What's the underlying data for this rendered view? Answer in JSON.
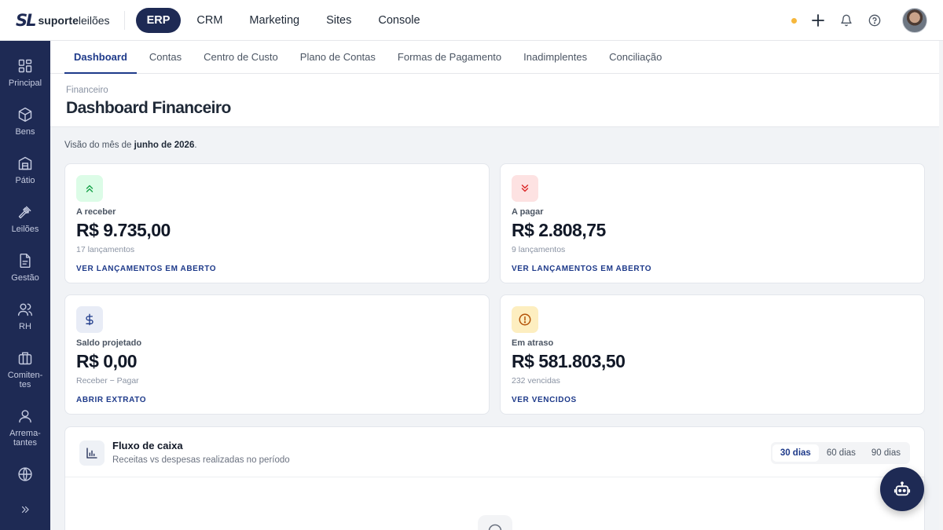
{
  "brand": {
    "mark": "SL",
    "name_bold": "suporte",
    "name_rest": "leilões"
  },
  "top_nav": [
    {
      "label": "ERP",
      "active": true
    },
    {
      "label": "CRM",
      "active": false
    },
    {
      "label": "Marketing",
      "active": false
    },
    {
      "label": "Sites",
      "active": false
    },
    {
      "label": "Console",
      "active": false
    }
  ],
  "top_right": {
    "status_dot_color": "#f6b73c",
    "icons": [
      "plus-icon",
      "bell-icon",
      "help-icon"
    ],
    "avatar": "user-avatar"
  },
  "sidebar": {
    "items": [
      {
        "label": "Principal",
        "icon": "grid-icon"
      },
      {
        "label": "Bens",
        "icon": "box-icon"
      },
      {
        "label": "Pátio",
        "icon": "warehouse-icon"
      },
      {
        "label": "Leilões",
        "icon": "gavel-icon"
      },
      {
        "label": "Gestão",
        "icon": "document-icon"
      },
      {
        "label": "RH",
        "icon": "users-icon"
      },
      {
        "label": "Comiten-",
        "label2": "tes",
        "icon": "briefcase-icon"
      },
      {
        "label": "Arrema-",
        "label2": "tantes",
        "icon": "user-icon"
      },
      {
        "label": "",
        "icon": "globe-icon"
      }
    ],
    "expand_icon": "double-chevron-right-icon"
  },
  "tabs": [
    {
      "label": "Dashboard",
      "active": true
    },
    {
      "label": "Contas",
      "active": false
    },
    {
      "label": "Centro de Custo",
      "active": false
    },
    {
      "label": "Plano de Contas",
      "active": false
    },
    {
      "label": "Formas de Pagamento",
      "active": false
    },
    {
      "label": "Inadimplentes",
      "active": false
    },
    {
      "label": "Conciliação",
      "active": false
    }
  ],
  "page": {
    "breadcrumb": "Financeiro",
    "title": "Dashboard Financeiro",
    "overview_prefix": "Visão do mês de ",
    "overview_month": "junho de 2026",
    "overview_suffix": "."
  },
  "cards": {
    "receber": {
      "label": "A receber",
      "value": "R$ 9.735,00",
      "sub": "17 lançamentos",
      "link": "VER LANÇAMENTOS EM ABERTO",
      "icon": "double-chevron-up-icon",
      "color": "#16a34a"
    },
    "pagar": {
      "label": "A pagar",
      "value": "R$ 2.808,75",
      "sub": "9 lançamentos",
      "link": "VER LANÇAMENTOS EM ABERTO",
      "icon": "double-chevron-down-icon",
      "color": "#dc2626"
    },
    "saldo": {
      "label": "Saldo projetado",
      "value": "R$ 0,00",
      "sub": "Receber − Pagar",
      "link": "ABRIR EXTRATO",
      "icon": "dollar-icon",
      "color": "#1e3a8a"
    },
    "atraso": {
      "label": "Em atraso",
      "value": "R$ 581.803,50",
      "sub": "232 vencidas",
      "link": "VER VENCIDOS",
      "icon": "alert-circle-icon",
      "color": "#b45309"
    }
  },
  "cash_flow": {
    "title": "Fluxo de caixa",
    "subtitle": "Receitas vs despesas realizadas no período",
    "periods": [
      {
        "label": "30 dias",
        "active": true
      },
      {
        "label": "60 dias",
        "active": false
      },
      {
        "label": "90 dias",
        "active": false
      }
    ]
  },
  "assistant_button": {
    "icon": "robot-icon"
  }
}
